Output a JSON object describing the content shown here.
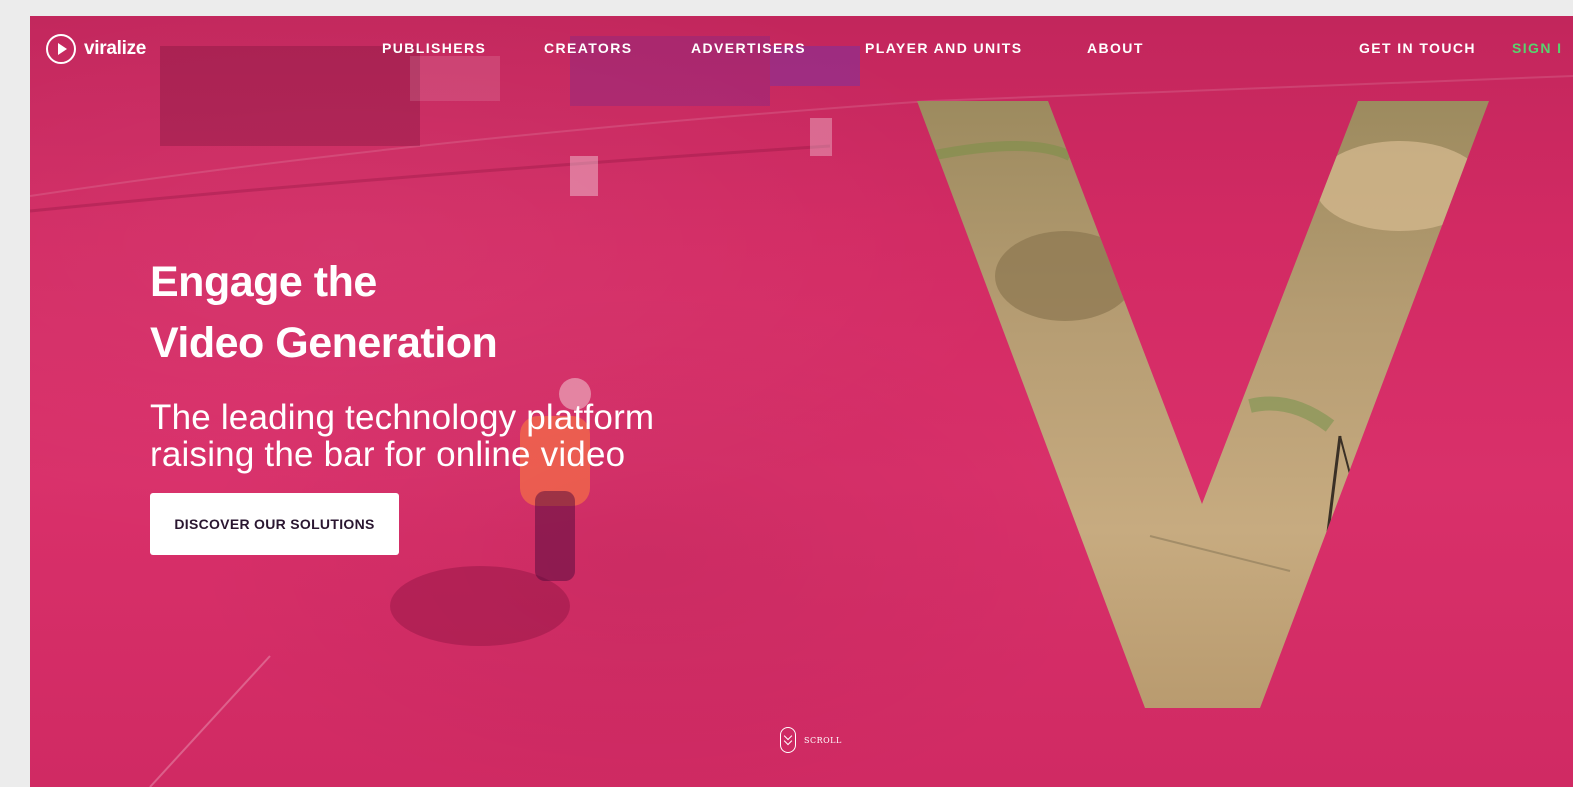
{
  "brand": {
    "name": "viralize",
    "logo_icon": "play-circle-icon"
  },
  "nav": {
    "items": [
      {
        "label": "PUBLISHERS"
      },
      {
        "label": "CREATORS"
      },
      {
        "label": "ADVERTISERS"
      },
      {
        "label": "PLAYER AND UNITS"
      },
      {
        "label": "ABOUT"
      }
    ],
    "contact_label": "GET IN TOUCH",
    "signin_label": "SIGN I"
  },
  "hero": {
    "headline_line1": "Engage the",
    "headline_line2": "Video Generation",
    "subhead_line1": "The leading technology platform",
    "subhead_line2": "raising the bar for online video",
    "cta_label": "DISCOVER OUR SOLUTIONS",
    "scroll_label": "SCROLL",
    "scroll_icon": "scroll-down-icon"
  },
  "colors": {
    "overlay": "#d22a63",
    "signin": "#58d36e",
    "cta_text": "#2a1630",
    "page_bg": "#ececec"
  }
}
